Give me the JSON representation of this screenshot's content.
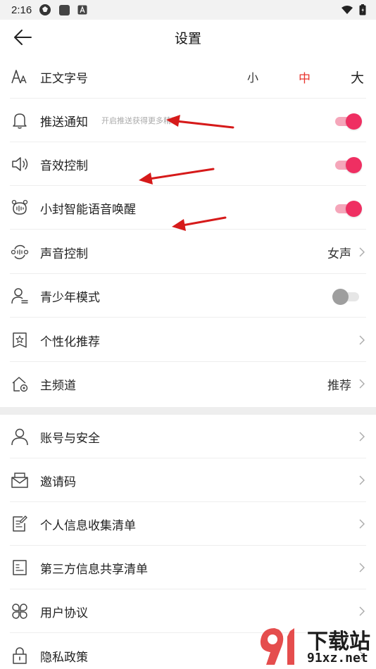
{
  "status_bar": {
    "time": "2:16"
  },
  "header": {
    "title": "设置"
  },
  "font_size": {
    "small": "小",
    "medium": "中",
    "large": "大",
    "selected_color": "#e8352e"
  },
  "rows": [
    {
      "label": "正文字号",
      "icon": "font-size-icon"
    },
    {
      "label": "推送通知",
      "sub": "开启推送获得更多精彩",
      "toggle": "on",
      "icon": "bell-icon"
    },
    {
      "label": "音效控制",
      "toggle": "on",
      "icon": "speaker-icon"
    },
    {
      "label": "小封智能语音唤醒",
      "toggle": "on",
      "icon": "voice-robot-icon"
    },
    {
      "label": "声音控制",
      "value": "女声",
      "icon": "voice-switch-icon"
    },
    {
      "label": "青少年模式",
      "toggle": "off",
      "icon": "teen-user-icon"
    },
    {
      "label": "个性化推荐",
      "icon": "star-bookmark-icon"
    },
    {
      "label": "主频道",
      "value": "推荐",
      "icon": "home-settings-icon"
    },
    {
      "label": "账号与安全",
      "icon": "user-icon"
    },
    {
      "label": "邀请码",
      "icon": "envelope-icon"
    },
    {
      "label": "个人信息收集清单",
      "icon": "edit-document-icon"
    },
    {
      "label": "第三方信息共享清单",
      "icon": "document-list-icon"
    },
    {
      "label": "用户协议",
      "icon": "clover-icon"
    },
    {
      "label": "隐私政策",
      "icon": "lock-icon"
    }
  ],
  "watermark": {
    "brand": "下载站",
    "domain": "91xz.net"
  },
  "colors": {
    "accent": "#ef2f62",
    "toggle_track_on": "#f5a6ba",
    "annotation_arrow": "#d61a1a"
  }
}
